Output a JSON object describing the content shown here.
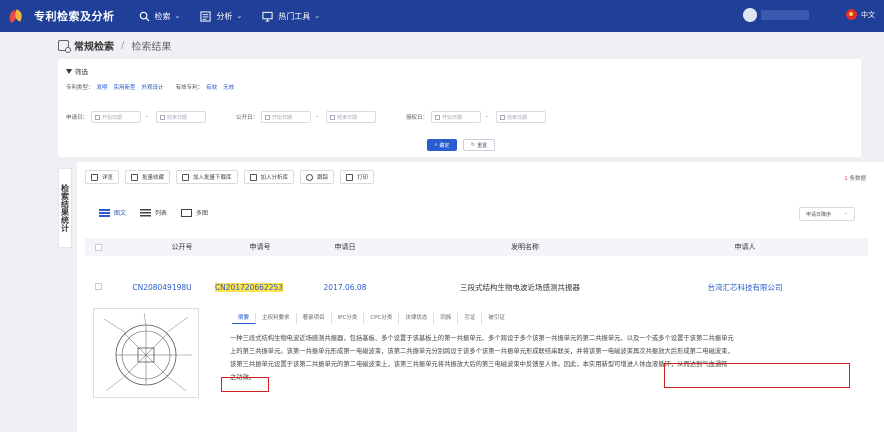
{
  "app": {
    "title": "专利检索及分析"
  },
  "nav": [
    {
      "label": "检索",
      "icon": "search-icon"
    },
    {
      "label": "分析",
      "icon": "chart-icon"
    },
    {
      "label": "热门工具",
      "icon": "monitor-icon"
    }
  ],
  "lang": {
    "label": "中文"
  },
  "breadcrumb": {
    "root": "常规检索",
    "sep": "/",
    "current": "检索结果"
  },
  "filter": {
    "title": "筛选",
    "type_label": "专利类型：",
    "types": [
      "发明",
      "实用新型",
      "外观设计"
    ],
    "valid_label": "有效专利：",
    "valid": [
      "有效",
      "无效"
    ],
    "apply_date": "申请日：",
    "pub_date": "公开日：",
    "grant_date": "授权日：",
    "start_ph": "开始日期",
    "end_ph": "结束日期",
    "dash": "-",
    "ok": "确定",
    "reset": "重置"
  },
  "side_tab": "检索结果统计",
  "toolbar": [
    "详览",
    "批量收藏",
    "加入批量下载库",
    "加入分析库",
    "跟踪",
    "打印"
  ],
  "count": {
    "n": "1",
    "suffix": "条数据"
  },
  "views": [
    "图文",
    "列表",
    "多图"
  ],
  "sort": {
    "label": "申请日降序",
    "icon": "chevron-down-icon"
  },
  "table": {
    "headers": [
      "公开号",
      "申请号",
      "申请日",
      "发明名称",
      "申请人"
    ],
    "row": {
      "pub_no": "CN208049198U",
      "app_no": "CN201720662253",
      "date": "2017.06.08",
      "name": "三段式结构生物电波近场感测共振器",
      "applicant": "台湾汇芯科技有限公司"
    }
  },
  "detail_tabs": [
    "摘要",
    "主权利要求",
    "著录项目",
    "IPC分类",
    "CPC分类",
    "法律状态",
    "同族",
    "引证",
    "被引证"
  ],
  "abstract": {
    "l1": "一种三段式结构生物电波近场感测共振器，包括基板、多个设置于该基板上的第一共振单元、多个跨设于多个该第一共振单元的第二共振单元、以及一个或多个设置于该第二共振单元",
    "l2": "上的第三共振单元。该第一共振单元形成第一电磁波束，该第二共振单元分别跨设于该多个该第一共振单元形成联结串联关，并将该第一电磁波束再次共振放大后形成第二电磁波束，",
    "l3": "该第三共振单元设置于该第二共振单元的第二电磁波束上，该第三共振单元将共振放大后的第三电磁波束中反馈至人体。因此，本实用新型可增进人体血液循环，从而达到气血通畅",
    "l4": "之功效。"
  }
}
